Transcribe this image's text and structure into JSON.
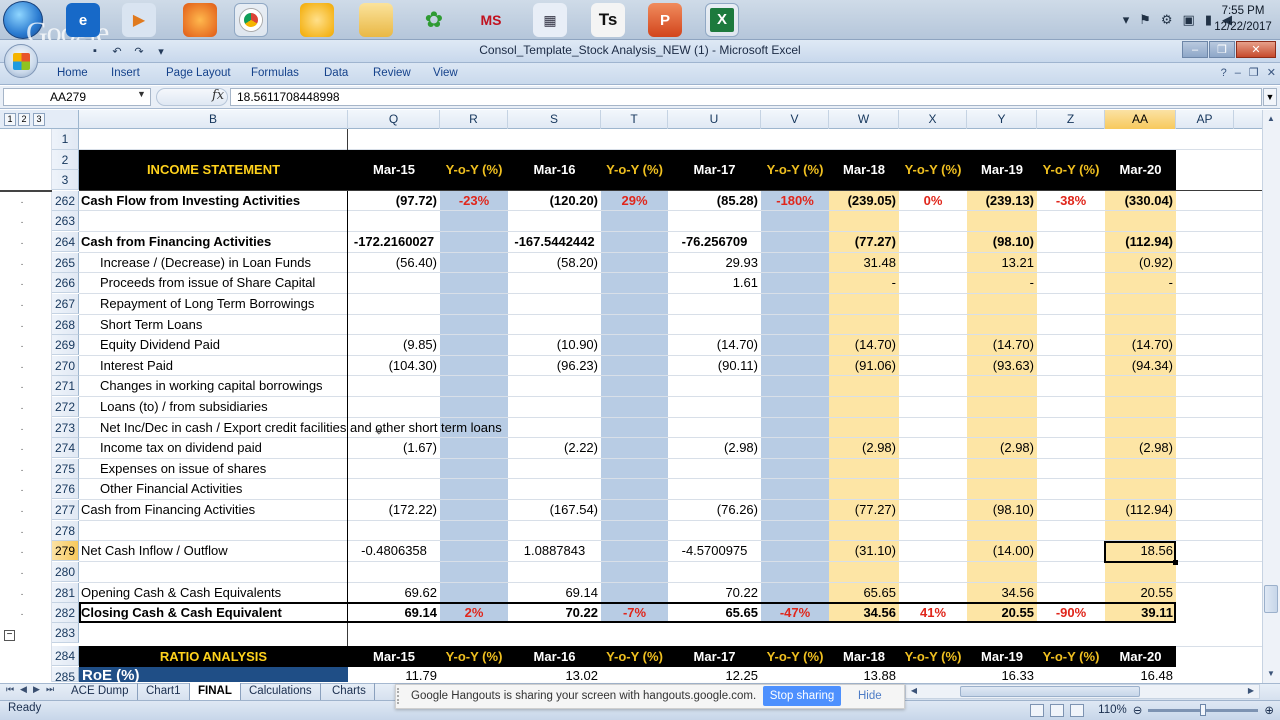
{
  "taskbar": {
    "tray_icons": [
      "chevron-up-icon",
      "flag-icon",
      "network-icon",
      "signal-icon",
      "volume-icon"
    ],
    "clock_time": "7:55 PM",
    "clock_date": "12/22/2017"
  },
  "window": {
    "title": "Consol_Template_Stock Analysis_NEW (1) - Microsoft Excel"
  },
  "ribbon": {
    "tabs": [
      "Home",
      "Insert",
      "Page Layout",
      "Formulas",
      "Data",
      "Review",
      "View"
    ]
  },
  "formula_bar": {
    "name_box": "AA279",
    "fx": "fx",
    "value": "18.5611708448998"
  },
  "outline_levels": [
    "1",
    "2",
    "3"
  ],
  "columns": [
    "B",
    "Q",
    "R",
    "S",
    "T",
    "U",
    "V",
    "W",
    "X",
    "Y",
    "Z",
    "AA",
    "AP"
  ],
  "header_row": {
    "title": "INCOME STATEMENT",
    "periods": [
      "Mar-15",
      "Y-o-Y (%)",
      "Mar-16",
      "Y-o-Y (%)",
      "Mar-17",
      "Y-o-Y (%)",
      "Mar-18",
      "Y-o-Y (%)",
      "Mar-19",
      "Y-o-Y (%)",
      "Mar-20"
    ]
  },
  "rows": [
    {
      "num": "262",
      "label": "Cash Flow from Investing Activities",
      "q": "(97.72)",
      "r": "-23%",
      "s": "(120.20)",
      "t": "29%",
      "u": "(85.28)",
      "v": "-180%",
      "w": "(239.05)",
      "x": "0%",
      "y": "(239.13)",
      "z": "-38%",
      "aa": "(330.04)"
    },
    {
      "num": "263",
      "label": "",
      "q": "",
      "r": "",
      "s": "",
      "t": "",
      "u": "",
      "v": "",
      "w": "",
      "x": "",
      "y": "",
      "z": "",
      "aa": ""
    },
    {
      "num": "264",
      "label": "Cash from Financing Activities",
      "q": "-172.2160027",
      "r": "",
      "s": "-167.5442442",
      "t": "",
      "u": "-76.256709",
      "v": "",
      "w": "(77.27)",
      "x": "",
      "y": "(98.10)",
      "z": "",
      "aa": "(112.94)"
    },
    {
      "num": "265",
      "label": "Increase / (Decrease) in Loan Funds",
      "q": "(56.40)",
      "r": "",
      "s": "(58.20)",
      "t": "",
      "u": "29.93",
      "v": "",
      "w": "31.48",
      "x": "",
      "y": "13.21",
      "z": "",
      "aa": "(0.92)"
    },
    {
      "num": "266",
      "label": "Proceeds from issue of Share Capital",
      "q": "",
      "r": "",
      "s": "",
      "t": "",
      "u": "1.61",
      "v": "",
      "w": "-",
      "x": "",
      "y": "-",
      "z": "",
      "aa": "-"
    },
    {
      "num": "267",
      "label": "Repayment of Long Term Borrowings",
      "q": "",
      "r": "",
      "s": "",
      "t": "",
      "u": "",
      "v": "",
      "w": "",
      "x": "",
      "y": "",
      "z": "",
      "aa": ""
    },
    {
      "num": "268",
      "label": "Short Term Loans",
      "q": "",
      "r": "",
      "s": "",
      "t": "",
      "u": "",
      "v": "",
      "w": "",
      "x": "",
      "y": "",
      "z": "",
      "aa": ""
    },
    {
      "num": "269",
      "label": "Equity Dividend Paid",
      "q": "(9.85)",
      "r": "",
      "s": "(10.90)",
      "t": "",
      "u": "(14.70)",
      "v": "",
      "w": "(14.70)",
      "x": "",
      "y": "(14.70)",
      "z": "",
      "aa": "(14.70)"
    },
    {
      "num": "270",
      "label": "Interest Paid",
      "q": "(104.30)",
      "r": "",
      "s": "(96.23)",
      "t": "",
      "u": "(90.11)",
      "v": "",
      "w": "(91.06)",
      "x": "",
      "y": "(93.63)",
      "z": "",
      "aa": "(94.34)"
    },
    {
      "num": "271",
      "label": "Changes in working capital borrowings",
      "q": "",
      "r": "",
      "s": "",
      "t": "",
      "u": "",
      "v": "",
      "w": "",
      "x": "",
      "y": "",
      "z": "",
      "aa": ""
    },
    {
      "num": "272",
      "label": "Loans (to) / from subsidiaries",
      "q": "",
      "r": "",
      "s": "",
      "t": "",
      "u": "",
      "v": "",
      "w": "",
      "x": "",
      "y": "",
      "z": "",
      "aa": ""
    },
    {
      "num": "273",
      "label": "Net Inc/Dec in cash / Export credit facilities and other short term loans",
      "q": "",
      "r": "",
      "s": "",
      "t": "",
      "u": "",
      "v": "",
      "w": "",
      "x": "",
      "y": "",
      "z": "",
      "aa": ""
    },
    {
      "num": "274",
      "label": "Income tax on dividend paid",
      "q": "(1.67)",
      "r": "",
      "s": "(2.22)",
      "t": "",
      "u": "(2.98)",
      "v": "",
      "w": "(2.98)",
      "x": "",
      "y": "(2.98)",
      "z": "",
      "aa": "(2.98)"
    },
    {
      "num": "275",
      "label": "Expenses on issue of shares",
      "q": "",
      "r": "",
      "s": "",
      "t": "",
      "u": "",
      "v": "",
      "w": "",
      "x": "",
      "y": "",
      "z": "",
      "aa": ""
    },
    {
      "num": "276",
      "label": "Other Financial Activities",
      "q": "",
      "r": "",
      "s": "",
      "t": "",
      "u": "",
      "v": "",
      "w": "",
      "x": "",
      "y": "",
      "z": "",
      "aa": ""
    },
    {
      "num": "277",
      "label": "Cash from Financing Activities",
      "q": "(172.22)",
      "r": "",
      "s": "(167.54)",
      "t": "",
      "u": "(76.26)",
      "v": "",
      "w": "(77.27)",
      "x": "",
      "y": "(98.10)",
      "z": "",
      "aa": "(112.94)"
    },
    {
      "num": "278",
      "label": "",
      "q": "",
      "r": "",
      "s": "",
      "t": "",
      "u": "",
      "v": "",
      "w": "",
      "x": "",
      "y": "",
      "z": "",
      "aa": ""
    },
    {
      "num": "279",
      "label": "Net Cash Inflow / Outflow",
      "q": "-0.4806358",
      "r": "",
      "s": "1.0887843",
      "t": "",
      "u": "-4.5700975",
      "v": "",
      "w": "(31.10)",
      "x": "",
      "y": "(14.00)",
      "z": "",
      "aa": "18.56"
    },
    {
      "num": "280",
      "label": "",
      "q": "",
      "r": "",
      "s": "",
      "t": "",
      "u": "",
      "v": "",
      "w": "",
      "x": "",
      "y": "",
      "z": "",
      "aa": ""
    },
    {
      "num": "281",
      "label": "Opening Cash & Cash Equivalents",
      "q": "69.62",
      "r": "",
      "s": "69.14",
      "t": "",
      "u": "70.22",
      "v": "",
      "w": "65.65",
      "x": "",
      "y": "34.56",
      "z": "",
      "aa": "20.55"
    },
    {
      "num": "282",
      "label": "Closing Cash & Cash Equivalent",
      "q": "69.14",
      "r": "2%",
      "s": "70.22",
      "t": "-7%",
      "u": "65.65",
      "v": "-47%",
      "w": "34.56",
      "x": "41%",
      "y": "20.55",
      "z": "-90%",
      "aa": "39.11"
    },
    {
      "num": "283",
      "label": "",
      "q": "",
      "r": "",
      "s": "",
      "t": "",
      "u": "",
      "v": "",
      "w": "",
      "x": "",
      "y": "",
      "z": "",
      "aa": ""
    }
  ],
  "ratio_header": {
    "num": "284",
    "title": "RATIO ANALYSIS",
    "periods": [
      "Mar-15",
      "Y-o-Y (%)",
      "Mar-16",
      "Y-o-Y (%)",
      "Mar-17",
      "Y-o-Y (%)",
      "Mar-18",
      "Y-o-Y (%)",
      "Mar-19",
      "Y-o-Y (%)",
      "Mar-20"
    ]
  },
  "roe_row": {
    "num": "285",
    "label": "RoE (%)",
    "q": "11.79",
    "s": "13.02",
    "u": "12.25",
    "w": "13.88",
    "y": "16.33",
    "aa": "16.48"
  },
  "sheets": [
    "ACE Dump",
    "Chart1",
    "FINAL",
    "Calculations",
    "Charts"
  ],
  "active_sheet": "FINAL",
  "status": {
    "ready": "Ready",
    "zoom": "110%"
  },
  "share_bar": {
    "message": "Google Hangouts is sharing your screen with hangouts.google.com.",
    "stop": "Stop sharing",
    "hide": "Hide"
  },
  "colors": {
    "blue_band": "#b8cce4",
    "yellow_band": "#fde5a5",
    "header_bg": "#000000",
    "header_yellow": "#ffd21c",
    "yoy_red": "#e0261b",
    "roe_blue": "#1f4e86"
  }
}
